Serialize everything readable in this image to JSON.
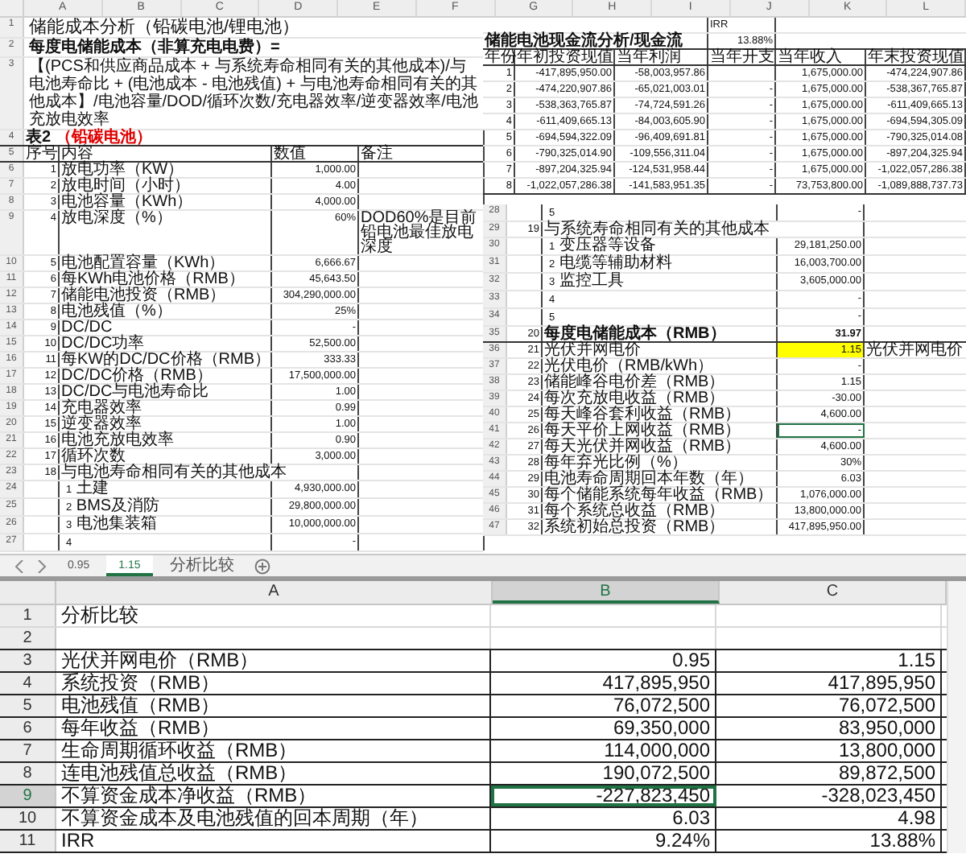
{
  "top_sheet": {
    "column_headers": [
      "A",
      "B",
      "C",
      "D",
      "E",
      "F",
      "G",
      "H",
      "I",
      "J",
      "K",
      "L"
    ],
    "title": {
      "row": "1",
      "text": "储能成本分析（铅碳电池/锂电池）"
    },
    "subtitle": {
      "row": "2",
      "text": "每度电储能成本（非算充电电费）="
    },
    "formula": {
      "row": "3",
      "text": "【(PCS和供应商品成本 + 与系统寿命相同有关的其他成本)/与电池寿命比 + (电池成本 - 电池残值) + 与电池寿命相同有关的其他成本】/电池容量/DOD/循环次数/充电器效率/逆变器效率/电池充放电效率"
    },
    "table_label": {
      "row": "4",
      "text": "表2",
      "note": "（铅碳电池）"
    },
    "table_header": {
      "row": "5",
      "cells": [
        "序号",
        "内容",
        "数值",
        "备注"
      ]
    },
    "rows": [
      {
        "row": "6",
        "kind": "item",
        "no": "1",
        "label": "放电功率（KW）",
        "value": "1,000.00",
        "highlighted": false,
        "selected": false
      },
      {
        "row": "7",
        "kind": "item",
        "no": "2",
        "label": "放电时间（小时）",
        "value": "4.00",
        "highlighted": false,
        "selected": false
      },
      {
        "row": "8",
        "kind": "item",
        "no": "3",
        "label": "电池容量（KWh）",
        "value": "4,000.00",
        "highlighted": false,
        "selected": false
      },
      {
        "row": "9",
        "kind": "item",
        "no": "4",
        "label": "放电深度（%）",
        "value": "60%",
        "note": "DOD60%是目前铅电池最佳放电深度",
        "highlighted": false,
        "selected": false
      },
      {
        "row": "10",
        "kind": "item",
        "no": "5",
        "label": "电池配置容量（KWh）",
        "value": "6,666.67",
        "highlighted": false,
        "selected": false
      },
      {
        "row": "11",
        "kind": "item",
        "no": "6",
        "label": "每KWh电池价格（RMB）",
        "value": "45,643.50",
        "highlighted": false,
        "selected": false
      },
      {
        "row": "12",
        "kind": "item",
        "no": "7",
        "label": "储能电池投资（RMB）",
        "value": "304,290,000.00",
        "highlighted": false,
        "selected": false
      },
      {
        "row": "13",
        "kind": "item",
        "no": "8",
        "label": "电池残值（%）",
        "value": "25%",
        "highlighted": false,
        "selected": false
      },
      {
        "row": "14",
        "kind": "item",
        "no": "9",
        "label": "DC/DC",
        "value": "-",
        "highlighted": false,
        "selected": false
      },
      {
        "row": "15",
        "kind": "item",
        "no": "10",
        "label": "DC/DC功率",
        "value": "52,500.00",
        "highlighted": false,
        "selected": false
      },
      {
        "row": "16",
        "kind": "item",
        "no": "11",
        "label": "每KW的DC/DC价格（RMB）",
        "value": "333.33",
        "highlighted": false,
        "selected": false
      },
      {
        "row": "17",
        "kind": "item",
        "no": "12",
        "label": "DC/DC价格（RMB）",
        "value": "17,500,000.00",
        "highlighted": false,
        "selected": false
      },
      {
        "row": "18",
        "kind": "item",
        "no": "13",
        "label": "DC/DC与电池寿命比",
        "value": "1.00",
        "highlighted": false,
        "selected": false
      },
      {
        "row": "19",
        "kind": "item",
        "no": "14",
        "label": "充电器效率",
        "value": "0.99",
        "highlighted": false,
        "selected": false
      },
      {
        "row": "20",
        "kind": "item",
        "no": "15",
        "label": "逆变器效率",
        "value": "1.00",
        "highlighted": false,
        "selected": false
      },
      {
        "row": "21",
        "kind": "item",
        "no": "16",
        "label": "电池充放电效率",
        "value": "0.90",
        "highlighted": false,
        "selected": false
      },
      {
        "row": "22",
        "kind": "item",
        "no": "17",
        "label": "循环次数",
        "value": "3,000.00",
        "highlighted": false,
        "selected": false
      },
      {
        "row": "23",
        "kind": "group",
        "no": "18",
        "label": "与电池寿命相同有关的其他成本",
        "highlighted": false,
        "selected": false
      },
      {
        "row": "24",
        "kind": "sub",
        "index": "1",
        "label": "土建",
        "value": "4,930,000.00",
        "highlighted": false,
        "selected": false
      },
      {
        "row": "25",
        "kind": "sub",
        "index": "2",
        "label": "BMS及消防",
        "value": "29,800,000.00",
        "highlighted": false,
        "selected": false
      },
      {
        "row": "26",
        "kind": "sub",
        "index": "3",
        "label": "电池集装箱",
        "value": "10,000,000.00",
        "highlighted": false,
        "selected": false
      },
      {
        "row": "27",
        "kind": "sub",
        "index": "4",
        "value": "-",
        "highlighted": false,
        "selected": false
      },
      {
        "row": "28",
        "kind": "sub",
        "index": "5",
        "value": "-",
        "highlighted": false,
        "selected": false
      },
      {
        "row": "29",
        "kind": "group",
        "no": "19",
        "label": "与系统寿命相同有关的其他成本",
        "highlighted": false,
        "selected": false
      },
      {
        "row": "30",
        "kind": "sub",
        "index": "1",
        "label": "变压器等设备",
        "value": "29,181,250.00",
        "highlighted": false,
        "selected": false
      },
      {
        "row": "31",
        "kind": "sub",
        "index": "2",
        "label": "电缆等辅助材料",
        "value": "16,003,700.00",
        "highlighted": false,
        "selected": false
      },
      {
        "row": "32",
        "kind": "sub",
        "index": "3",
        "label": "监控工具",
        "value": "3,605,000.00",
        "highlighted": false,
        "selected": false
      },
      {
        "row": "33",
        "kind": "sub",
        "index": "4",
        "value": "-",
        "highlighted": false,
        "selected": false
      },
      {
        "row": "34",
        "kind": "sub",
        "index": "5",
        "value": "-",
        "highlighted": false,
        "selected": false
      },
      {
        "row": "35",
        "kind": "total",
        "no": "20",
        "label": "每度电储能成本（RMB）",
        "value": "31.97",
        "highlighted": false,
        "selected": false
      },
      {
        "row": "36",
        "kind": "item",
        "no": "21",
        "label": "光伏并网电价",
        "value": "1.15",
        "note": "光伏并网电价",
        "highlighted": true,
        "selected": false
      },
      {
        "row": "37",
        "kind": "item",
        "no": "22",
        "label": "光伏电价（RMB/kWh）",
        "value": "-",
        "highlighted": false,
        "selected": false
      },
      {
        "row": "38",
        "kind": "item",
        "no": "23",
        "label": "储能峰谷电价差（RMB）",
        "value": "1.15",
        "highlighted": false,
        "selected": false
      },
      {
        "row": "39",
        "kind": "item",
        "no": "24",
        "label": "每次充放电收益（RMB）",
        "value": "-30.00",
        "highlighted": false,
        "selected": false
      },
      {
        "row": "40",
        "kind": "item",
        "no": "25",
        "label": "每天峰谷套利收益（RMB）",
        "value": "4,600.00",
        "highlighted": false,
        "selected": false
      },
      {
        "row": "41",
        "kind": "item",
        "no": "26",
        "label": "每天平价上网收益（RMB）",
        "value": "-",
        "highlighted": false,
        "selected": true
      },
      {
        "row": "42",
        "kind": "item",
        "no": "27",
        "label": "每天光伏并网收益（RMB）",
        "value": "4,600.00",
        "highlighted": false,
        "selected": false
      },
      {
        "row": "43",
        "kind": "item",
        "no": "28",
        "label": "每年弃光比例（%）",
        "value": "30%",
        "highlighted": false,
        "selected": false
      },
      {
        "row": "44",
        "kind": "item",
        "no": "29",
        "label": "电池寿命周期回本年数（年）",
        "value": "6.03",
        "highlighted": false,
        "selected": false
      },
      {
        "row": "45",
        "kind": "item",
        "no": "30",
        "label": "每个储能系统每年收益（RMB）",
        "value": "1,076,000.00",
        "highlighted": false,
        "selected": false
      },
      {
        "row": "46",
        "kind": "item",
        "no": "31",
        "label": "每个系统总收益（RMB）",
        "value": "13,800,000.00",
        "highlighted": false,
        "selected": false
      },
      {
        "row": "47",
        "kind": "item",
        "no": "32",
        "label": "系统初始总投资（RMB）",
        "value": "417,895,950.00",
        "highlighted": false,
        "selected": false
      }
    ],
    "cash_flow": {
      "irr_label": "IRR",
      "title": "储能电池现金流分析/现金流",
      "irr_value": "13.88%",
      "columns": [
        "年份",
        "年初投资现值",
        "当年利润",
        "当年开支",
        "当年收入",
        "年末投资现值"
      ],
      "rows": [
        [
          "1",
          "-417,895,950.00",
          "-58,003,957.86",
          "",
          "1,675,000.00",
          "-474,224,907.86"
        ],
        [
          "2",
          "-474,220,907.86",
          "-65,021,003.01",
          "-",
          "1,675,000.00",
          "-538,367,765.87"
        ],
        [
          "3",
          "-538,363,765.87",
          "-74,724,591.26",
          "-",
          "1,675,000.00",
          "-611,409,665.13"
        ],
        [
          "4",
          "-611,409,665.13",
          "-84,003,605.90",
          "-",
          "1,675,000.00",
          "-694,594,305.09"
        ],
        [
          "5",
          "-694,594,322.09",
          "-96,409,691.81",
          "-",
          "1,675,000.00",
          "-790,325,014.08"
        ],
        [
          "6",
          "-790,325,014.90",
          "-109,556,311.04",
          "-",
          "1,675,000.00",
          "-897,204,325.94"
        ],
        [
          "7",
          "-897,204,325.94",
          "-124,531,958.44",
          "-",
          "1,675,000.00",
          "-1,022,057,286.38"
        ],
        [
          "8",
          "-1,022,057,286.38",
          "-141,583,951.35",
          "-",
          "73,753,800.00",
          "-1,089,888,737.73"
        ]
      ]
    },
    "tabs": [
      {
        "label": "0.95",
        "selected": false
      },
      {
        "label": "1.15",
        "selected": true
      },
      {
        "label": "分析比较",
        "selected": false
      }
    ]
  },
  "bottom_sheet": {
    "columns": [
      {
        "label": "A",
        "selected": false
      },
      {
        "label": "B",
        "selected": true
      },
      {
        "label": "C",
        "selected": false
      }
    ],
    "rows": [
      {
        "row": "1",
        "a": "分析比较",
        "selected": false
      },
      {
        "row": "2",
        "selected": false
      },
      {
        "row": "3",
        "a": "光伏并网电价（RMB）",
        "b": "0.95",
        "c": "1.15",
        "selected": false
      },
      {
        "row": "4",
        "a": "系统投资（RMB）",
        "b": "417,895,950",
        "c": "417,895,950",
        "selected": false
      },
      {
        "row": "5",
        "a": "电池残值（RMB）",
        "b": "76,072,500",
        "c": "76,072,500",
        "selected": false
      },
      {
        "row": "6",
        "a": "每年收益（RMB）",
        "b": "69,350,000",
        "c": "83,950,000",
        "selected": false
      },
      {
        "row": "7",
        "a": "生命周期循环收益（RMB）",
        "b": "114,000,000",
        "c": "13,800,000",
        "selected": false
      },
      {
        "row": "8",
        "a": "连电池残值总收益（RMB）",
        "b": "190,072,500",
        "c": "89,872,500",
        "selected": false
      },
      {
        "row": "9",
        "a": "不算资金成本净收益（RMB）",
        "b": "-227,823,450",
        "c": "-328,023,450",
        "selected": true
      },
      {
        "row": "10",
        "a": "不算资金成本及电池残值的回本周期（年）",
        "b": "6.03",
        "c": "4.98",
        "selected": false
      },
      {
        "row": "11",
        "a": "IRR",
        "b": "9.24%",
        "c": "13.88%",
        "selected": false
      }
    ]
  }
}
